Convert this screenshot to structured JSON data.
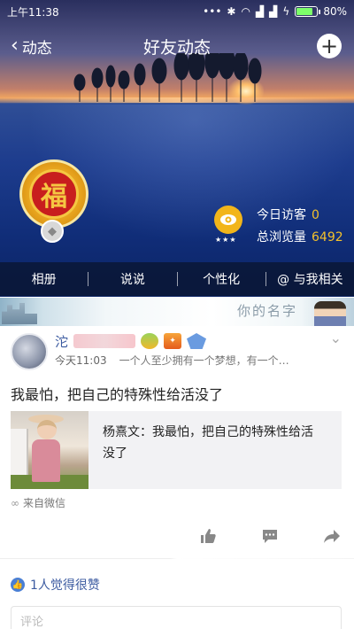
{
  "status_bar": {
    "time": "上午11:38",
    "battery_text": "80%",
    "battery_level": 0.8,
    "icons": [
      "dots-icon",
      "bluetooth-icon",
      "wifi-icon",
      "signal-icon",
      "signal-icon",
      "charging-icon",
      "battery-icon"
    ]
  },
  "header": {
    "back_label": "动态",
    "title": "好友动态",
    "add_icon": "plus-icon"
  },
  "profile": {
    "avatar_char": "福",
    "visitors_today_label": "今日访客",
    "visitors_today_value": "0",
    "total_views_label": "总浏览量",
    "total_views_value": "6492",
    "stars": "★★★"
  },
  "tabs": [
    {
      "label": "相册"
    },
    {
      "label": "说说"
    },
    {
      "label": "个性化"
    },
    {
      "label": "@ 与我相关"
    }
  ],
  "banner": {
    "name_text": "你的名字"
  },
  "post": {
    "author_name_visible": "沱",
    "time": "今天11:03",
    "signature": "一个人至少拥有一个梦想，有一个…",
    "text": "我最怕，把自己的特殊性给活没了",
    "share": {
      "line1": "杨熹文：我最怕，把自己的特殊性给活",
      "line2": "没了"
    },
    "source": "来自微信",
    "likes_text": "1人觉得很赞",
    "comment_placeholder": "评论"
  },
  "colors": {
    "accent_blue": "#3b5aa0",
    "gold": "#f4c12b",
    "tab_bar": "#0a142d"
  }
}
